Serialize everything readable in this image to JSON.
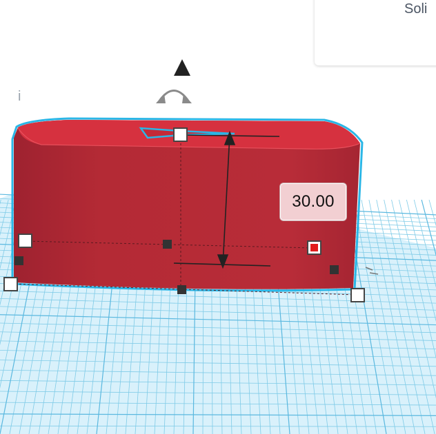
{
  "panel": {
    "title": "Soli"
  },
  "dimension": {
    "value": "30.00"
  },
  "icons": {
    "up_arrow": "arrow-up-icon",
    "rotate": "rotate-arrow-icon",
    "small_marker": "i"
  },
  "colors": {
    "shape_front": "#b42a35",
    "shape_top": "#d42f3d",
    "selection_outline": "#2bb6e6",
    "grid_background": "#d9f1fb",
    "grid_line": "#7fcbe7",
    "handle_fill": "#ffffff",
    "handle_selected": "#e11d1d",
    "handle_dark": "#333333",
    "label_fill": "#f2cfd2"
  }
}
